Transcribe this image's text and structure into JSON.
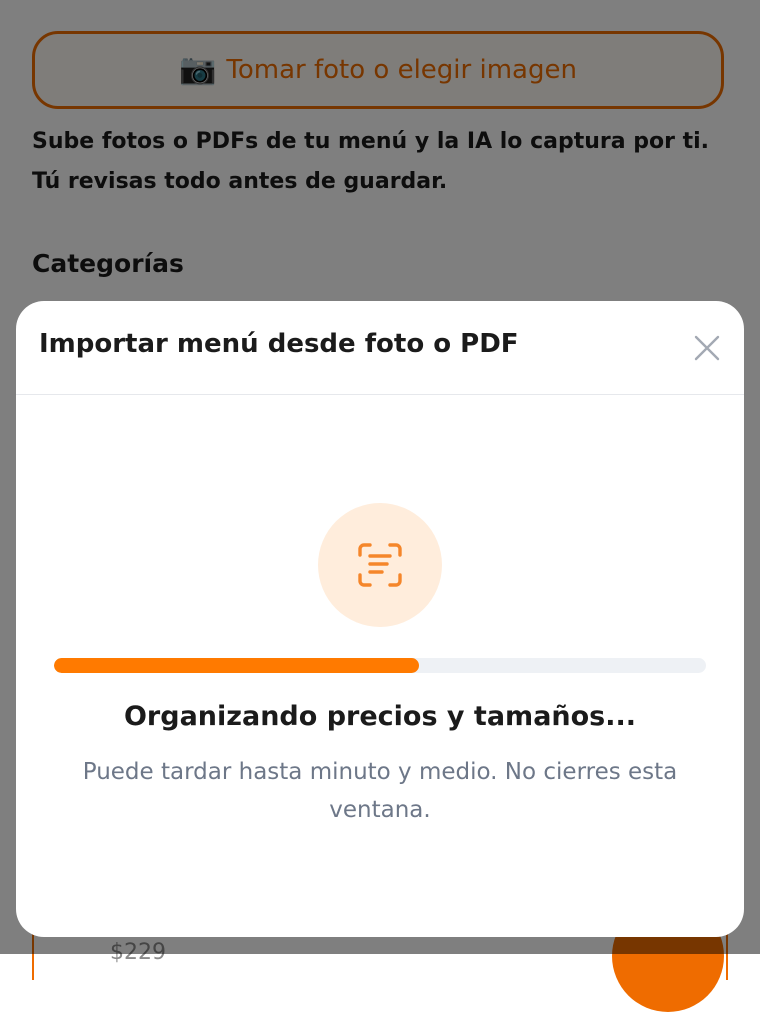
{
  "background": {
    "photo_button": {
      "icon": "camera-icon",
      "glyph": "📷",
      "label": "Tomar foto o elegir imagen"
    },
    "help_text": "Sube fotos o PDFs de tu menú y la IA lo captura por ti. Tú revisas todo antes de guardar.",
    "section_title": "Categorías",
    "price_fragment": "$229"
  },
  "modal": {
    "title": "Importar menú desde foto o PDF",
    "close_icon": "close-icon",
    "scan_icon": "document-scan-icon",
    "progress": 0.56,
    "status_title": "Organizando precios y tamaños...",
    "status_subtitle": "Puede tardar hasta minuto y medio. No cierres esta ventana."
  },
  "colors": {
    "accent": "#ff7a00",
    "accent_border": "#ef6c00",
    "badge_bg": "#ffeddc",
    "track": "#eef1f5",
    "muted_text": "#6d7788"
  }
}
